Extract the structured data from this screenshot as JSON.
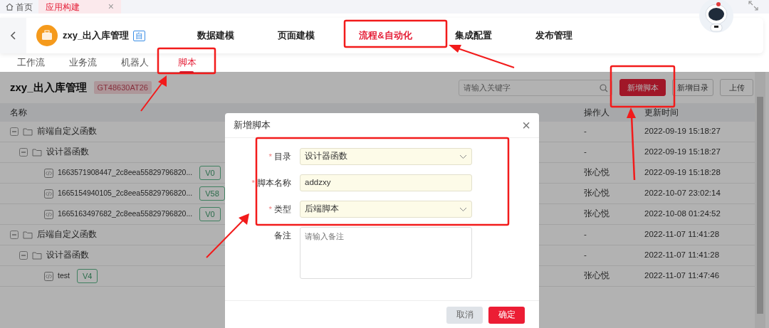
{
  "top_tabs": [
    {
      "kind": "home",
      "label": "首页",
      "selected": false
    },
    {
      "kind": "page",
      "label": "应用构建",
      "selected": true,
      "close": "×"
    }
  ],
  "app": {
    "name": "zxy_出入库管理",
    "badge": "自"
  },
  "nav": [
    {
      "label": "数据建模",
      "selected": false
    },
    {
      "label": "页面建模",
      "selected": false
    },
    {
      "label": "流程&自动化",
      "selected": true
    },
    {
      "label": "集成配置",
      "selected": false
    },
    {
      "label": "发布管理",
      "selected": false
    }
  ],
  "subtabs": [
    {
      "label": "工作流",
      "selected": false
    },
    {
      "label": "业务流",
      "selected": false
    },
    {
      "label": "机器人",
      "selected": false
    },
    {
      "label": "脚本",
      "selected": true
    }
  ],
  "page": {
    "title": "zxy_出入库管理",
    "code": "GT48630AT26"
  },
  "search": {
    "placeholder": "请输入关键字"
  },
  "toolbar_buttons": [
    {
      "label": "新增脚本",
      "kind": "primary"
    },
    {
      "label": "新增目录",
      "kind": "outline"
    },
    {
      "label": "上传",
      "kind": "outline"
    }
  ],
  "table": {
    "columns": [
      "名称",
      "操作人",
      "更新时间"
    ],
    "rows": [
      {
        "kind": "folder",
        "name": "前端自定义函数",
        "expanded": true,
        "operator": "-",
        "updated": "2022-09-19 15:18:27",
        "children": [
          {
            "kind": "folder",
            "name": "设计器函数",
            "expanded": true,
            "operator": "-",
            "updated": "2022-09-19 15:18:27",
            "children": [
              {
                "kind": "script",
                "name": "1663571908447_2c8eea55829796820...",
                "version": "V0",
                "operator": "张心悦",
                "updated": "2022-09-19 15:18:28"
              },
              {
                "kind": "script",
                "name": "1665154940105_2c8eea55829796820...",
                "version": "V58",
                "operator": "张心悦",
                "updated": "2022-10-07 23:02:14"
              },
              {
                "kind": "script",
                "name": "1665163497682_2c8eea55829796820...",
                "version": "V0",
                "operator": "张心悦",
                "updated": "2022-10-08 01:24:52"
              }
            ]
          }
        ]
      },
      {
        "kind": "folder",
        "name": "后端自定义函数",
        "expanded": true,
        "operator": "-",
        "updated": "2022-11-07 11:41:28",
        "children": [
          {
            "kind": "folder",
            "name": "设计器函数",
            "expanded": true,
            "operator": "-",
            "updated": "2022-11-07 11:41:28",
            "children": [
              {
                "kind": "script",
                "name": "test",
                "version": "V4",
                "operator": "张心悦",
                "updated": "2022-11-07 11:47:46"
              }
            ]
          }
        ]
      }
    ]
  },
  "modal": {
    "title": "新增脚本",
    "close": "×",
    "fields": [
      {
        "label": "目录",
        "required_mark": "*",
        "kind": "select",
        "value": "设计器函数"
      },
      {
        "label": "脚本名称",
        "required_mark": "*",
        "kind": "input",
        "value": "addzxy"
      },
      {
        "label": "类型",
        "required_mark": "*",
        "kind": "select",
        "value": "后端脚本"
      },
      {
        "label": "备注",
        "kind": "textarea",
        "placeholder": "请输入备注"
      }
    ],
    "buttons": [
      {
        "label": "取消",
        "kind": "secondary"
      },
      {
        "label": "确定",
        "kind": "primary"
      }
    ]
  }
}
